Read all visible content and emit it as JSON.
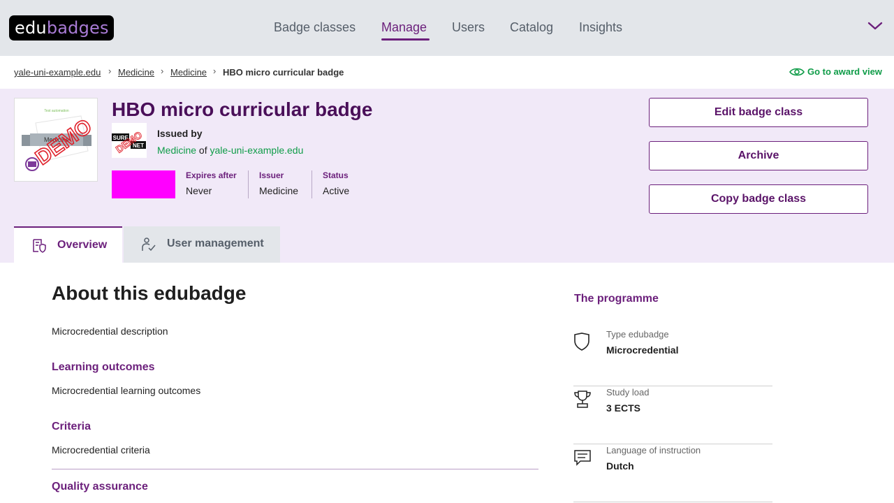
{
  "app": {
    "logo_part1": "edu",
    "logo_part2": "badges"
  },
  "nav": {
    "items": [
      {
        "label": "Badge classes",
        "active": false
      },
      {
        "label": "Manage",
        "active": true
      },
      {
        "label": "Users",
        "active": false
      },
      {
        "label": "Catalog",
        "active": false
      },
      {
        "label": "Insights",
        "active": false
      }
    ],
    "menu_icon": "chevron-down-icon"
  },
  "breadcrumb": {
    "items": [
      "yale-uni-example.edu",
      "Medicine",
      "Medicine",
      "HBO micro curricular badge"
    ],
    "award_view_label": "Go to award view"
  },
  "badge": {
    "title": "HBO micro curricular badge",
    "image_text": "Test automation",
    "image_ribbon": "Medicine",
    "demo_stamp": "DEMO",
    "issued_by_label": "Issued by",
    "issuer_faculty": "Medicine",
    "issuer_of": "of",
    "issuer_institution": "yale-uni-example.edu",
    "issuer_logo_top": "SURF",
    "issuer_logo_bottom": "NET",
    "swatch_color": "#ff00ff",
    "meta": [
      {
        "label": "Expires after",
        "value": "Never"
      },
      {
        "label": "Issuer",
        "value": "Medicine"
      },
      {
        "label": "Status",
        "value": "Active"
      }
    ]
  },
  "actions": {
    "edit": "Edit badge class",
    "archive": "Archive",
    "copy": "Copy badge class"
  },
  "tabs": [
    {
      "label": "Overview",
      "icon": "overview-icon",
      "active": true
    },
    {
      "label": "User management",
      "icon": "user-management-icon",
      "active": false
    }
  ],
  "main": {
    "heading": "About this edubadge",
    "description": "Microcredential description",
    "learning_outcomes_title": "Learning outcomes",
    "learning_outcomes": "Microcredential learning outcomes",
    "criteria_title": "Criteria",
    "criteria": "Microcredential criteria",
    "quality_title": "Quality assurance"
  },
  "programme": {
    "title": "The programme",
    "items": [
      {
        "label": "Type edubadge",
        "value": "Microcredential",
        "icon": "shield-icon"
      },
      {
        "label": "Study load",
        "value": "3 ECTS",
        "icon": "trophy-icon"
      },
      {
        "label": "Language of instruction",
        "value": "Dutch",
        "icon": "speech-bubble-icon"
      }
    ]
  },
  "colors": {
    "brand": "#6b1f7b",
    "accent_green": "#0f9c48",
    "hero_bg": "#f1e9f8"
  }
}
